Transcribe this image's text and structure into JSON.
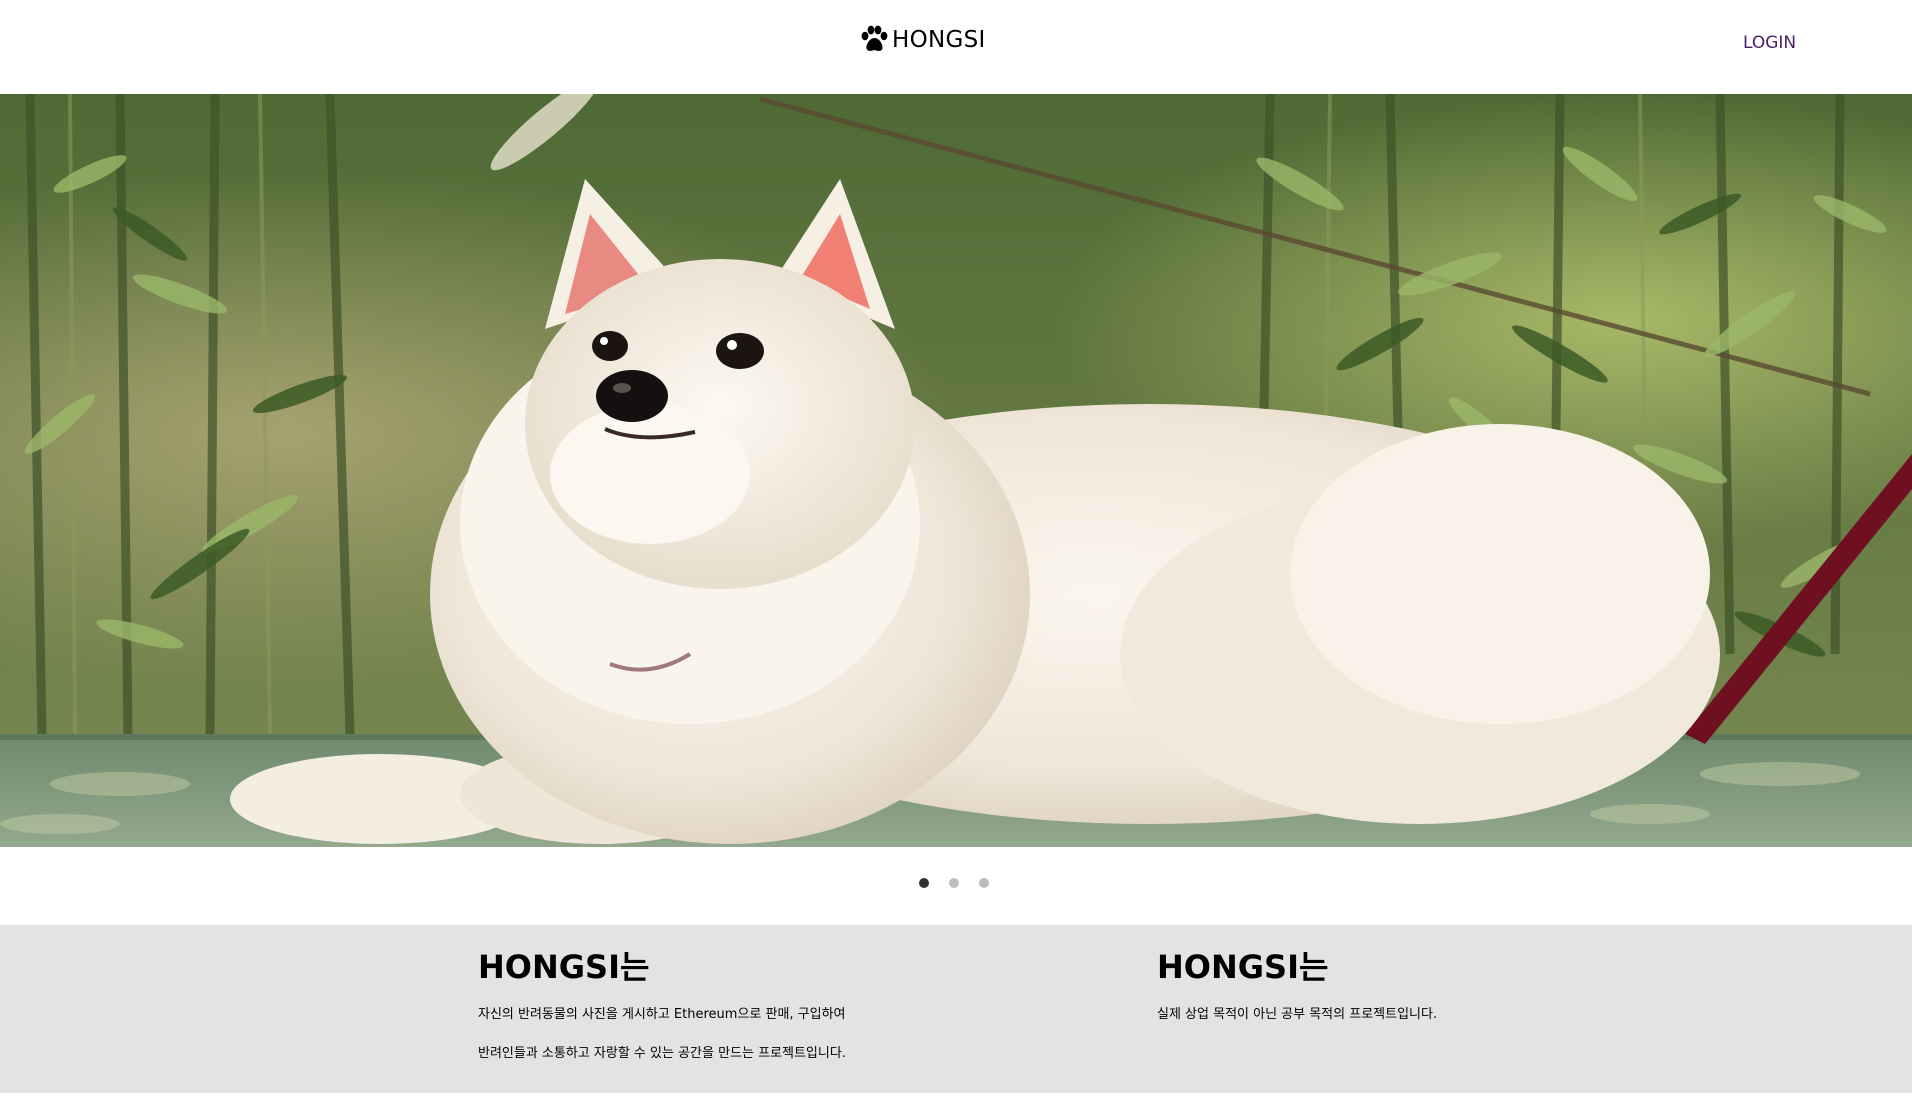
{
  "header": {
    "brand_icon": "paw-icon",
    "brand_text": "HONGSI",
    "login_label": "LOGIN",
    "login_color": "#4b1e6b"
  },
  "hero": {
    "subject": "white pomeranian lying on a wooden bench among bamboo",
    "slide_count": 3,
    "active_slide": 1
  },
  "info": {
    "left": {
      "title": "HONGSI는",
      "lines": [
        "자신의 반려동물의 사진을 게시하고 Ethereum으로 판매, 구입하여",
        "반려인들과 소통하고 자랑할 수 있는 공간을 만드는 프로젝트입니다."
      ]
    },
    "right": {
      "title": "HONGSI는",
      "lines": [
        "실제 상업 목적이 아닌 공부 목적의 프로젝트입니다."
      ]
    },
    "background": "#e3e3e3"
  }
}
